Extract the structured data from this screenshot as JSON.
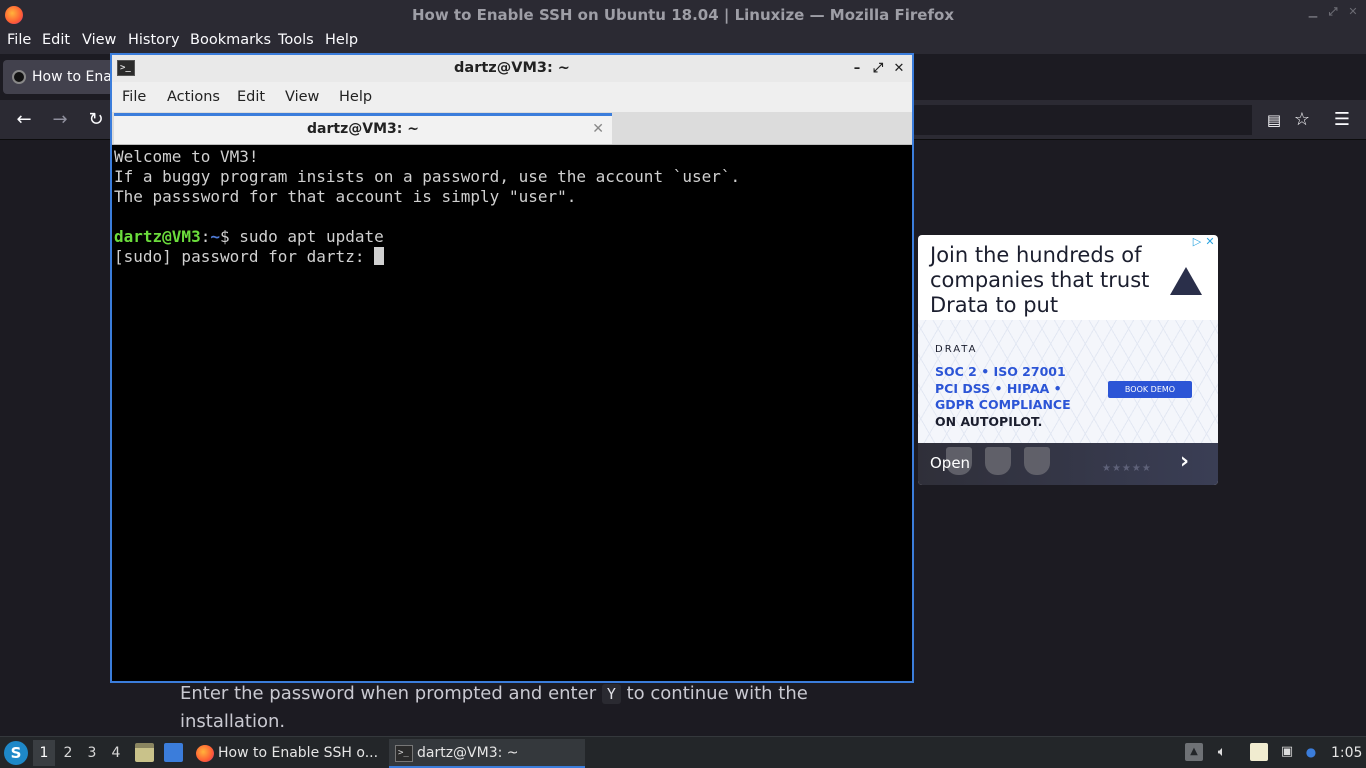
{
  "firefox": {
    "window_title": "How to Enable SSH on Ubuntu 18.04 | Linuxize — Mozilla Firefox",
    "menu": [
      "File",
      "Edit",
      "View",
      "History",
      "Bookmarks",
      "Tools",
      "Help"
    ],
    "tab_label": "How to Enable SSH on Ubuntu 18.04 | Linuxize",
    "icons": {
      "back": "back-arrow-icon",
      "forward": "forward-arrow-icon",
      "reload": "reload-icon",
      "reader": "reader-view-icon",
      "bookmark": "star-icon",
      "menu": "hamburger-menu-icon"
    }
  },
  "article": {
    "text_before": "Enter the password when prompted and enter ",
    "code": "Y",
    "text_after": " to continue with the installation."
  },
  "ad": {
    "headline": "Join the hundreds of companies that trust Drata to put",
    "brand": "DRATA",
    "lines": [
      "SOC 2 • ISO 27001",
      "PCI DSS • HIPAA •",
      "GDPR COMPLIANCE",
      "ON AUTOPILOT."
    ],
    "cta": "BOOK DEMO",
    "open_label": "Open",
    "choice_icon": "▷",
    "close_icon": "✕"
  },
  "terminal": {
    "title": "dartz@VM3: ~",
    "menu": [
      "File",
      "Actions",
      "Edit",
      "View",
      "Help"
    ],
    "tab_title": "dartz@VM3: ~",
    "lines": [
      "Welcome to VM3!",
      "If a buggy program insists on a password, use the account `user`.",
      "The passsword for that account is simply \"user\"."
    ],
    "prompt_user": "dartz@VM3",
    "prompt_sep": ":",
    "prompt_path": "~",
    "prompt_symbol": "$ ",
    "command": "sudo apt update",
    "sudo_prompt": "[sudo] password for dartz: "
  },
  "taskbar": {
    "workspaces": [
      "1",
      "2",
      "3",
      "4"
    ],
    "active_workspace": "1",
    "tasks": [
      {
        "label": "How to Enable SSH o...",
        "icon": "firefox-icon"
      },
      {
        "label": "dartz@VM3: ~",
        "icon": "terminal-icon"
      }
    ],
    "clock": "1:05"
  }
}
